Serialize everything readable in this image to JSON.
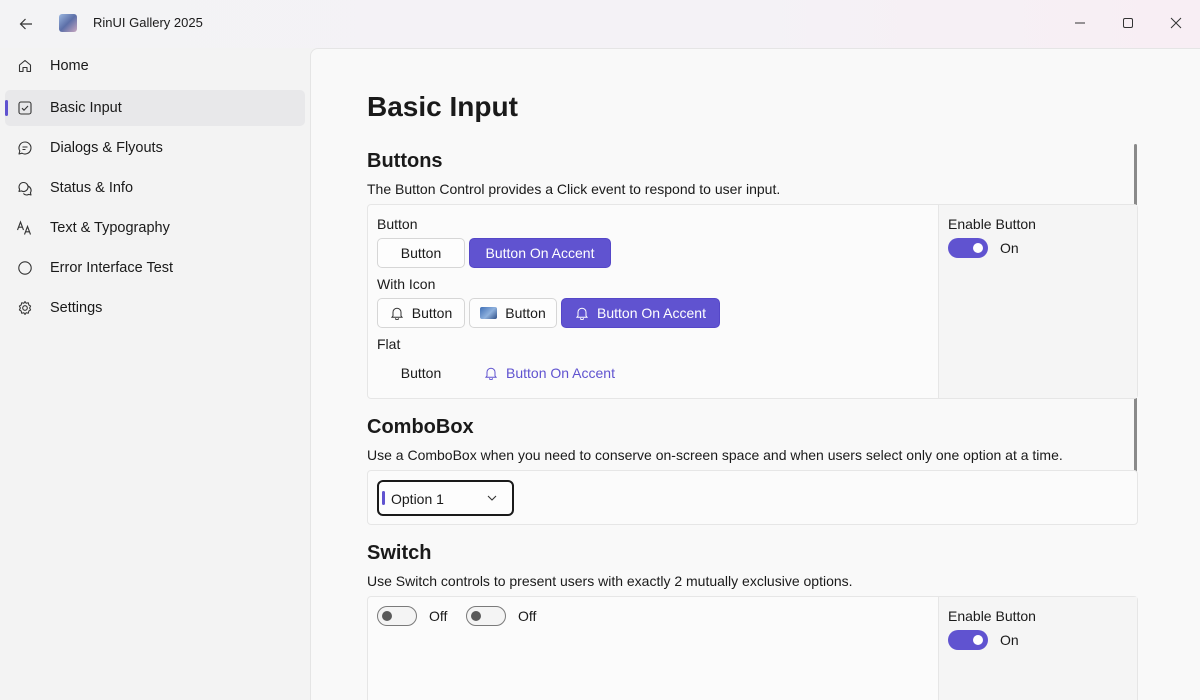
{
  "window": {
    "title": "RinUI Gallery 2025"
  },
  "sidebar": {
    "items": [
      {
        "label": "Home",
        "icon": "home-icon"
      },
      {
        "label": "Basic Input",
        "icon": "checkbox-icon",
        "active": true
      },
      {
        "label": "Dialogs & Flyouts",
        "icon": "chat-bubble-icon"
      },
      {
        "label": "Status & Info",
        "icon": "chat-multiple-icon"
      },
      {
        "label": "Text & Typography",
        "icon": "text-font-icon"
      },
      {
        "label": "Error Interface Test",
        "icon": "circle-icon"
      },
      {
        "label": "Settings",
        "icon": "gear-icon"
      }
    ]
  },
  "page": {
    "title": "Basic Input"
  },
  "buttons_section": {
    "title": "Buttons",
    "description": "The Button Control provides a Click event to respond to user input.",
    "group_button": "Button",
    "button_label": "Button",
    "accent_label": "Button On Accent",
    "group_with_icon": "With Icon",
    "group_flat": "Flat",
    "side": {
      "label": "Enable Button",
      "state": "On"
    }
  },
  "combobox_section": {
    "title": "ComboBox",
    "description": "Use a ComboBox when you need to conserve on-screen space and when users select only one option at a time.",
    "selected": "Option 1"
  },
  "switch_section": {
    "title": "Switch",
    "description": "Use Switch controls to present users with exactly 2 mutually exclusive options.",
    "switch1_state": "Off",
    "switch2_state": "Off",
    "side": {
      "label": "Enable Button",
      "state": "On"
    }
  },
  "colors": {
    "accent": "#6053d0"
  }
}
